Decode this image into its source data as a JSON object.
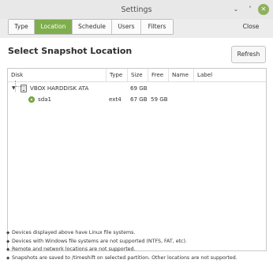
{
  "window": {
    "title": "Settings",
    "controls": {
      "minimize": "⌄",
      "maximize": "˄",
      "close": "✕"
    }
  },
  "toolbar": {
    "tabs": [
      {
        "label": "Type",
        "active": false
      },
      {
        "label": "Location",
        "active": true
      },
      {
        "label": "Schedule",
        "active": false
      },
      {
        "label": "Users",
        "active": false
      },
      {
        "label": "Filters",
        "active": false
      }
    ],
    "close_label": "Close"
  },
  "main": {
    "heading": "Select Snapshot Location",
    "refresh_label": "Refresh",
    "table": {
      "columns": [
        "Disk",
        "Type",
        "Size",
        "Free",
        "Name",
        "Label"
      ],
      "rows": [
        {
          "disk": "VBOX HARDDISK ATA",
          "type": "",
          "size": "69 GB",
          "free": "",
          "name": "",
          "label": "",
          "expander": "▼"
        },
        {
          "disk": "sda1",
          "type": "ext4",
          "size": "67 GB",
          "free": "59 GB",
          "name": "",
          "label": ""
        }
      ]
    },
    "notes": [
      "Devices displayed above have Linux file systems.",
      "Devices with Windows file systems are not supported (NTFS, FAT, etc).",
      "Remote and network locations are not supported.",
      "Snapshots are saved to /timeshift on selected partition. Other locations are not supported."
    ],
    "note_bullet": "◆"
  },
  "colors": {
    "accent": "#7fae4d",
    "window_bg": "#ececec",
    "panel_bg": "#ffffff"
  }
}
